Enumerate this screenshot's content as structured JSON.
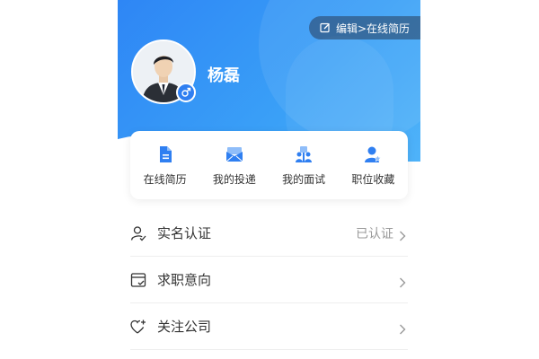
{
  "header": {
    "edit_label": "编辑>在线简历",
    "user_name": "杨磊"
  },
  "quick_actions": [
    {
      "label": "在线简历",
      "icon": "resume-icon"
    },
    {
      "label": "我的投递",
      "icon": "mail-icon"
    },
    {
      "label": "我的面试",
      "icon": "interview-icon"
    },
    {
      "label": "职位收藏",
      "icon": "favorite-user-icon"
    }
  ],
  "menu": [
    {
      "label": "实名认证",
      "status": "已认证",
      "icon": "user-verify-icon"
    },
    {
      "label": "求职意向",
      "status": "",
      "icon": "job-intent-icon"
    },
    {
      "label": "关注公司",
      "status": "",
      "icon": "heart-plus-icon"
    }
  ],
  "colors": {
    "primary": "#2e86f5",
    "text": "#333333",
    "muted": "#999999"
  }
}
